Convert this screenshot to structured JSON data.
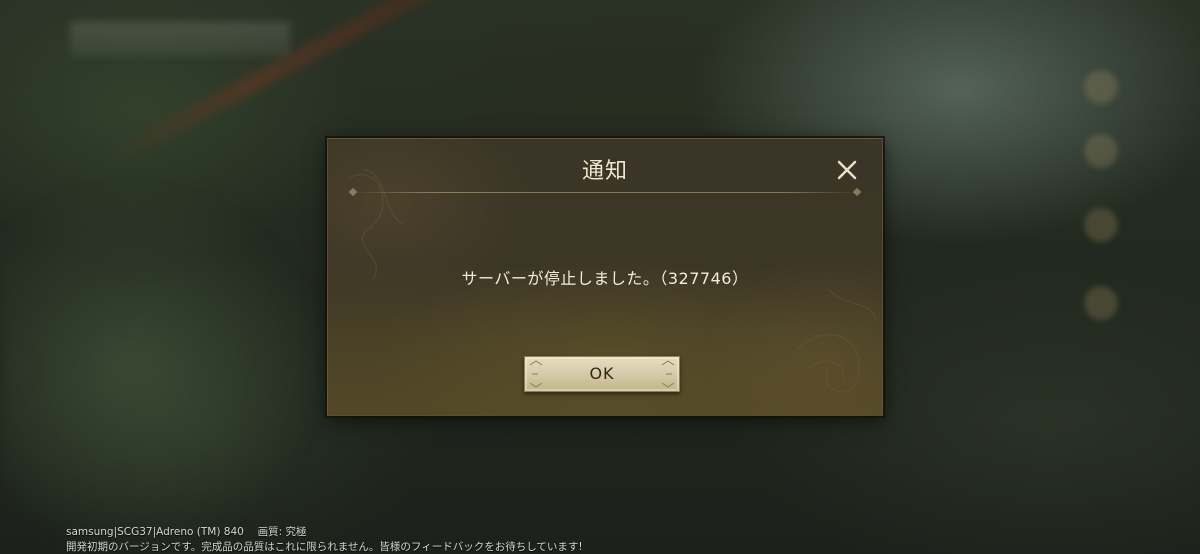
{
  "dialog": {
    "title": "通知",
    "message": "サーバーが停止しました。（327746）",
    "ok_label": "OK",
    "close_icon": "close-icon"
  },
  "footer": {
    "device_info": "samsung|SCG37|Adreno (TM) 840　 画質: 究極",
    "notice": "開発初期のバージョンです。完成品の品質はこれに限られません。皆様のフィードバックをお待ちしています!"
  },
  "colors": {
    "dialog_bg": "#3c3626",
    "title_text": "#efe6cf",
    "ok_button": "#d4c8a6"
  }
}
